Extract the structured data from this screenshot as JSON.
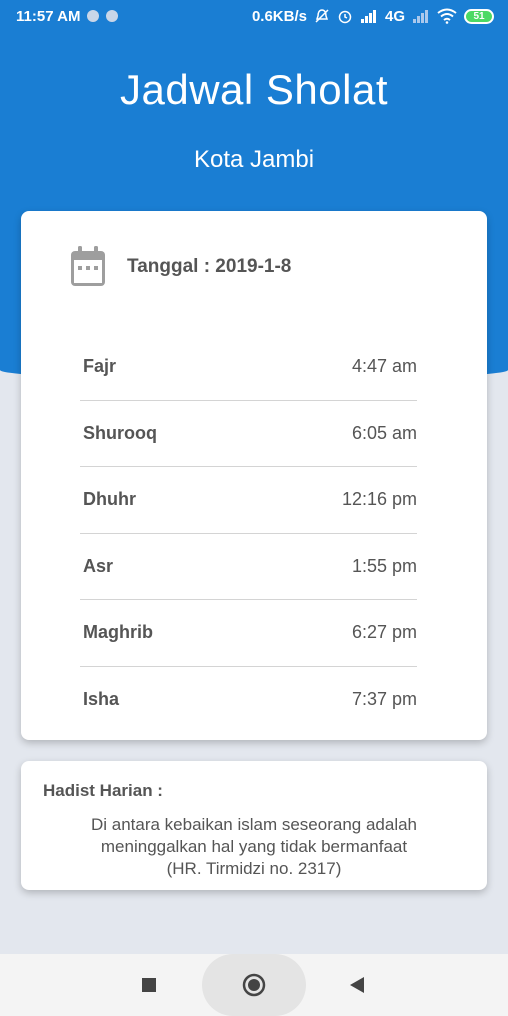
{
  "status_bar": {
    "time": "11:57 AM",
    "network_speed": "0.6KB/s",
    "network_type": "4G",
    "battery": "51"
  },
  "header": {
    "title": "Jadwal Sholat",
    "city": "Kota Jambi"
  },
  "date": {
    "label": "Tanggal : 2019-1-8",
    "icon": "calendar-icon"
  },
  "prayers": [
    {
      "name": "Fajr",
      "time": "4:47 am"
    },
    {
      "name": "Shurooq",
      "time": "6:05 am"
    },
    {
      "name": "Dhuhr",
      "time": "12:16 pm"
    },
    {
      "name": "Asr",
      "time": "1:55 pm"
    },
    {
      "name": "Maghrib",
      "time": "6:27 pm"
    },
    {
      "name": "Isha",
      "time": "7:37 pm"
    }
  ],
  "hadith": {
    "label": "Hadist Harian :",
    "lines": [
      "Di antara kebaikan islam seseorang adalah",
      "meninggalkan hal yang tidak bermanfaat",
      "(HR. Tirmidzi no. 2317)"
    ]
  },
  "nav": {
    "recent_icon": "square-icon",
    "home_icon": "circle-icon",
    "back_icon": "triangle-back-icon"
  },
  "colors": {
    "primary": "#1a7ed3",
    "background": "#e3e7ee",
    "card": "#ffffff",
    "text": "#555555"
  }
}
